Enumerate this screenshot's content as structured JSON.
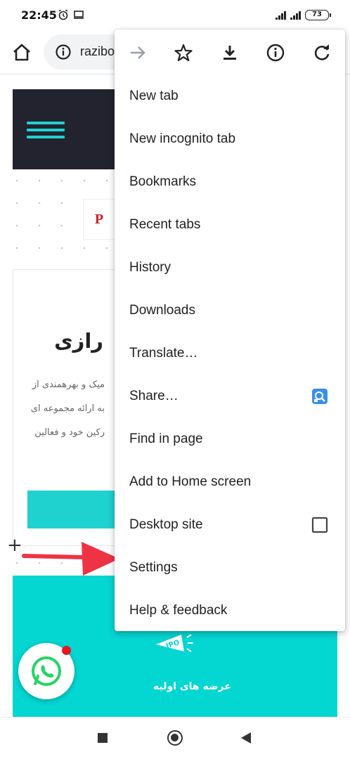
{
  "status_bar": {
    "time": "22:45",
    "icons": [
      "alarm-icon",
      "screen-cast-icon",
      "hd-signal-icon",
      "signal-icon"
    ],
    "battery": "73"
  },
  "toolbar": {
    "url_text": "razibo",
    "icons": [
      "home-icon",
      "info-icon"
    ]
  },
  "page": {
    "card_title": "رازی",
    "card_lines": [
      "میک و بهرهمندی از",
      "به ارائه مجموعه ای",
      "رکین خود و فعالین"
    ],
    "ipo_label": "عرضه های اولیه"
  },
  "menu": {
    "top_icons": [
      "forward-icon",
      "star-icon",
      "download-icon",
      "info-icon",
      "refresh-icon"
    ],
    "items": [
      {
        "label": "New tab"
      },
      {
        "label": "New incognito tab"
      },
      {
        "label": "Bookmarks"
      },
      {
        "label": "Recent tabs"
      },
      {
        "label": "History"
      },
      {
        "label": "Downloads"
      },
      {
        "label": "Translate…"
      },
      {
        "label": "Share…",
        "icon": "share-app-icon"
      },
      {
        "label": "Find in page"
      },
      {
        "label": "Add to Home screen"
      },
      {
        "label": "Desktop site",
        "checked": false
      },
      {
        "label": "Settings"
      },
      {
        "label": "Help & feedback"
      }
    ]
  },
  "colors": {
    "accent_teal": "#1fd1cf",
    "dark_hero": "#23232f",
    "annotation_red": "#ee3344",
    "share_icon_blue": "#3b8fe8"
  },
  "nav_bar": [
    "recents-icon",
    "home-icon",
    "back-icon"
  ]
}
